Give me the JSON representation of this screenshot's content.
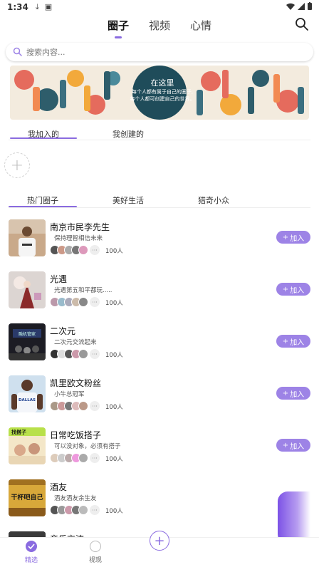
{
  "status": {
    "time": "1:34"
  },
  "top_tabs": [
    {
      "label": "圈子"
    },
    {
      "label": "视频"
    },
    {
      "label": "心情"
    }
  ],
  "search": {
    "placeholder": "搜索内容..."
  },
  "banner": {
    "title": "在这里",
    "line1": "每个人都有属于自己的圈子,",
    "line2": "每个人都可创建自己的世界。"
  },
  "sub_tabs": [
    {
      "label": "我加入的"
    },
    {
      "label": "我创建的"
    }
  ],
  "hot_tabs": [
    {
      "label": "热门圈子"
    },
    {
      "label": "美好生活"
    },
    {
      "label": "猎奇小众"
    }
  ],
  "join_label": "加入",
  "items": [
    {
      "title": "南京市民李先生",
      "desc": "保持理智相信未来",
      "count": "100人"
    },
    {
      "title": "光遇",
      "desc": "光遇第五和平都玩.....",
      "count": "100人"
    },
    {
      "title": "二次元",
      "desc": "二次元交流起来",
      "count": "100人"
    },
    {
      "title": "凯里欧文粉丝",
      "desc": "小牛总冠军",
      "count": "100人"
    },
    {
      "title": "日常吃饭搭子",
      "desc": "可以没对象，必须有搭子",
      "count": "100人"
    },
    {
      "title": "酒友",
      "desc": "酒友酒友余生友",
      "count": "100人"
    },
    {
      "title": "音乐交流",
      "desc": "",
      "count": ""
    }
  ],
  "thumb_text": {
    "item2": "融机管家",
    "item4": "DALLAS",
    "item5": "找搭子",
    "item6": "干杯吧自己"
  },
  "bottom_nav": [
    {
      "label": "精选"
    },
    {
      "label": "视现"
    }
  ],
  "colors": {
    "accent": "#8a6be0",
    "join": "#9d83e6"
  }
}
